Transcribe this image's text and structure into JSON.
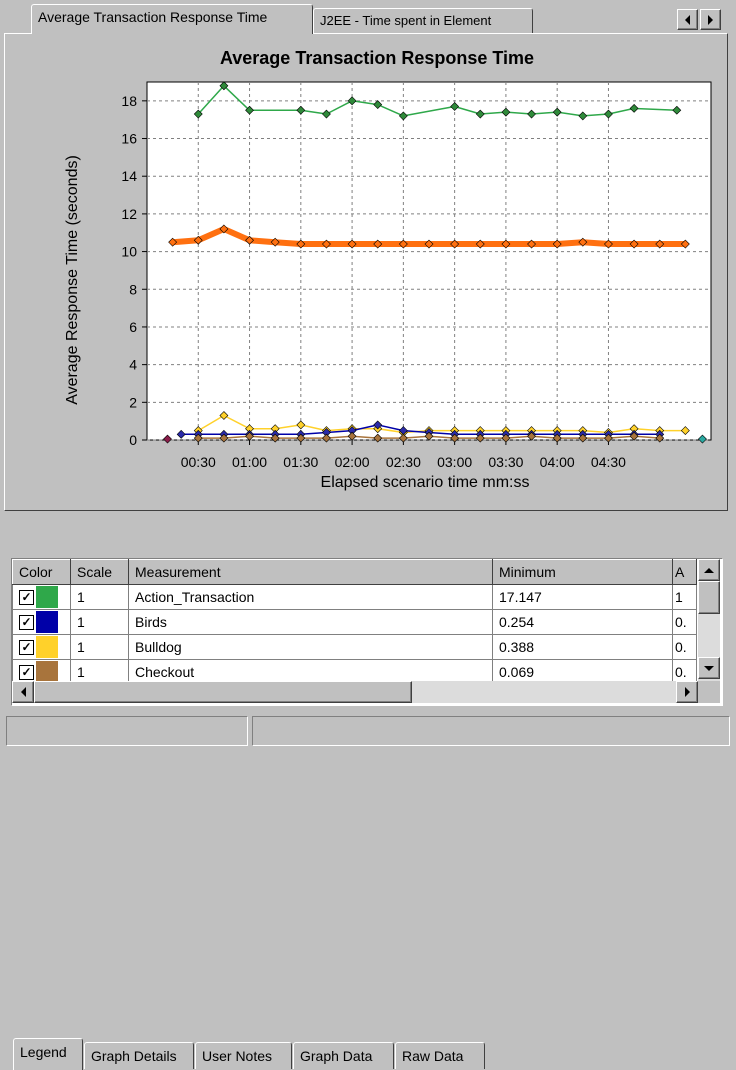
{
  "tabs": [
    {
      "label": "Average Transaction Response Time",
      "active": true
    },
    {
      "label": "J2EE - Time spent in Element",
      "active": false
    }
  ],
  "bottom_tabs": [
    {
      "label": "Legend",
      "active": true
    },
    {
      "label": "Graph Details",
      "active": false
    },
    {
      "label": "User Notes",
      "active": false
    },
    {
      "label": "Graph Data",
      "active": false
    },
    {
      "label": "Raw Data",
      "active": false
    }
  ],
  "icons": {
    "scroll_left": "arrow-left-icon",
    "scroll_right": "arrow-right-icon",
    "scroll_up": "arrow-up-icon",
    "scroll_down": "arrow-down-icon"
  },
  "legend": {
    "columns": [
      "Color",
      "Scale",
      "Measurement",
      "Minimum",
      "A"
    ],
    "rows": [
      {
        "checked": true,
        "color": "#2fa84a",
        "scale": "1",
        "measurement": "Action_Transaction",
        "minimum": "17.147",
        "avg": "1"
      },
      {
        "checked": true,
        "color": "#0000a8",
        "scale": "1",
        "measurement": "Birds",
        "minimum": "0.254",
        "avg": "0."
      },
      {
        "checked": true,
        "color": "#ffd12a",
        "scale": "1",
        "measurement": "Bulldog",
        "minimum": "0.388",
        "avg": "0."
      },
      {
        "checked": true,
        "color": "#a8743c",
        "scale": "1",
        "measurement": "Checkout",
        "minimum": "0.069",
        "avg": "0."
      }
    ]
  },
  "chart_data": {
    "type": "line",
    "title": "Average Transaction Response Time",
    "xlabel": "Elapsed scenario time mm:ss",
    "ylabel": "Average Response Time (seconds)",
    "xlim": [
      0,
      330
    ],
    "ylim": [
      0,
      19
    ],
    "yticks": [
      0,
      2,
      4,
      6,
      8,
      10,
      12,
      14,
      16,
      18
    ],
    "xticks": [
      30,
      60,
      90,
      120,
      150,
      180,
      210,
      240,
      270
    ],
    "xtick_labels": [
      "00:30",
      "01:00",
      "01:30",
      "02:00",
      "02:30",
      "03:00",
      "03:30",
      "04:00",
      "04:30"
    ],
    "grid": true,
    "series": [
      {
        "name": "Action_Transaction",
        "color": "#2fa84a",
        "marker": "#2f8a3a",
        "width": 1.5,
        "x": [
          30,
          45,
          60,
          90,
          105,
          120,
          135,
          150,
          180,
          195,
          210,
          225,
          240,
          255,
          270,
          285,
          310
        ],
        "y": [
          17.3,
          18.8,
          17.5,
          17.5,
          17.3,
          18.0,
          17.8,
          17.2,
          17.7,
          17.3,
          17.4,
          17.3,
          17.4,
          17.2,
          17.3,
          17.6,
          17.5
        ]
      },
      {
        "name": "",
        "color": "#ff7010",
        "marker": "#ff7010",
        "width": 6,
        "x": [
          15,
          30,
          45,
          60,
          75,
          90,
          105,
          120,
          135,
          150,
          165,
          180,
          195,
          210,
          225,
          240,
          255,
          270,
          285,
          300,
          315
        ],
        "y": [
          10.5,
          10.6,
          11.2,
          10.6,
          10.5,
          10.4,
          10.4,
          10.4,
          10.4,
          10.4,
          10.4,
          10.4,
          10.4,
          10.4,
          10.4,
          10.4,
          10.5,
          10.4,
          10.4,
          10.4,
          10.4
        ]
      },
      {
        "name": "Bulldog",
        "color": "#ffd12a",
        "marker": "#ffd12a",
        "width": 1.5,
        "x": [
          30,
          45,
          60,
          75,
          90,
          105,
          120,
          135,
          150,
          165,
          180,
          195,
          210,
          225,
          240,
          255,
          270,
          285,
          300,
          315
        ],
        "y": [
          0.5,
          1.3,
          0.6,
          0.6,
          0.8,
          0.5,
          0.6,
          0.6,
          0.4,
          0.5,
          0.5,
          0.5,
          0.5,
          0.5,
          0.5,
          0.5,
          0.4,
          0.6,
          0.5,
          0.5
        ]
      },
      {
        "name": "Birds",
        "color": "#0000a8",
        "marker": "#2a2aa8",
        "width": 1.5,
        "x": [
          20,
          30,
          45,
          60,
          75,
          90,
          105,
          120,
          135,
          150,
          165,
          180,
          195,
          210,
          225,
          240,
          255,
          270,
          285,
          300
        ],
        "y": [
          0.3,
          0.3,
          0.3,
          0.3,
          0.3,
          0.3,
          0.4,
          0.5,
          0.8,
          0.5,
          0.4,
          0.3,
          0.3,
          0.3,
          0.3,
          0.3,
          0.3,
          0.3,
          0.3,
          0.3
        ]
      },
      {
        "name": "Checkout",
        "color": "#a8743c",
        "marker": "#a8743c",
        "width": 1.5,
        "x": [
          30,
          45,
          60,
          75,
          90,
          105,
          120,
          135,
          150,
          165,
          180,
          195,
          210,
          225,
          240,
          255,
          270,
          285,
          300
        ],
        "y": [
          0.1,
          0.1,
          0.2,
          0.1,
          0.1,
          0.1,
          0.2,
          0.1,
          0.1,
          0.2,
          0.1,
          0.1,
          0.1,
          0.2,
          0.1,
          0.1,
          0.1,
          0.2,
          0.1
        ]
      },
      {
        "name": "",
        "color": "#8a1e4a",
        "marker": "#8a1e4a",
        "width": 1,
        "x": [
          12
        ],
        "y": [
          0.05
        ]
      },
      {
        "name": "",
        "color": "#2aa8a0",
        "marker": "#2aa8a0",
        "width": 1,
        "x": [
          325
        ],
        "y": [
          0.05
        ]
      }
    ]
  }
}
